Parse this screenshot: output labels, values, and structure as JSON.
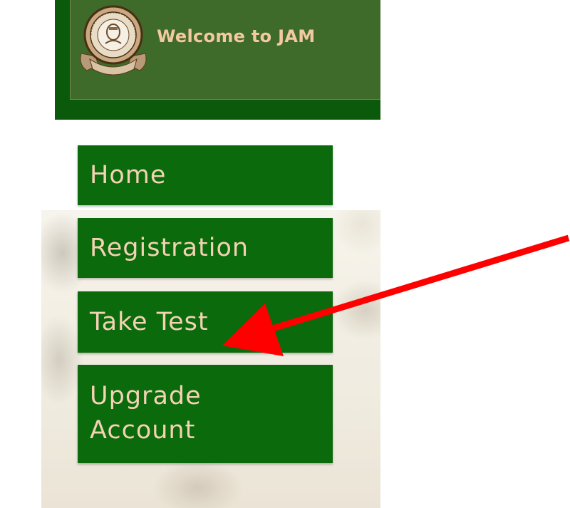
{
  "banner": {
    "welcome_text": "Welcome to JAM",
    "logo_icon": "jamb-crest-logo-icon",
    "colors": {
      "outer": "#0b5a0b",
      "inner": "#3f6b2a",
      "text": "#f2c9a0"
    }
  },
  "nav": {
    "items": [
      {
        "label": "Home"
      },
      {
        "label": "Registration"
      },
      {
        "label": "Take Test"
      },
      {
        "label_line1": "Upgrade",
        "label_line2": "Account"
      }
    ],
    "colors": {
      "background": "#0b6a0b",
      "text": "#f4d2b4"
    }
  },
  "annotation": {
    "arrow_icon": "red-arrow-icon",
    "color": "#ff0000"
  }
}
